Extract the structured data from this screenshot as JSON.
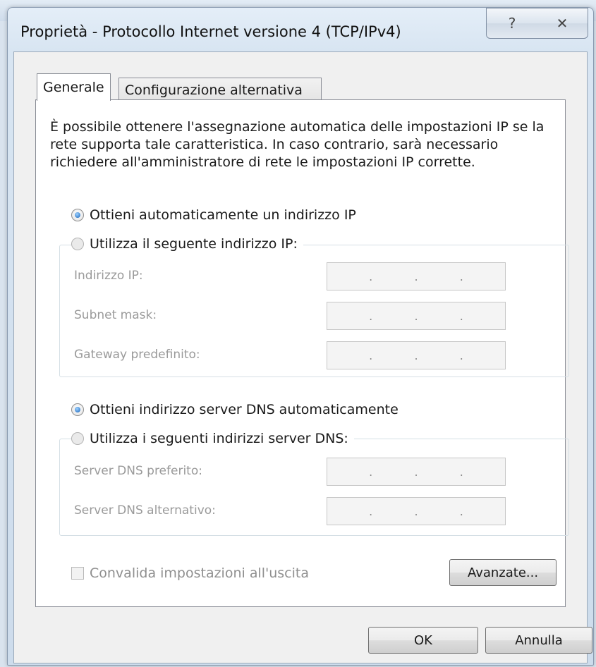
{
  "window": {
    "title": "Proprietà - Protocollo Internet versione 4 (TCP/IPv4)",
    "help_glyph": "?",
    "close_glyph": "✕"
  },
  "tabs": [
    {
      "label": "Generale",
      "active": true
    },
    {
      "label": "Configurazione alternativa",
      "active": false
    }
  ],
  "description": "È possibile ottenere l'assegnazione automatica delle impostazioni IP se la rete supporta tale caratteristica. In caso contrario, sarà necessario richiedere all'amministratore di rete le impostazioni IP corrette.",
  "ip": {
    "auto_label": "Ottieni automaticamente un indirizzo IP",
    "auto_selected": true,
    "manual_label": "Utilizza il seguente indirizzo IP:",
    "fields": [
      {
        "label": "Indirizzo IP:",
        "value": ". . ."
      },
      {
        "label": "Subnet mask:",
        "value": ". . ."
      },
      {
        "label": "Gateway predefinito:",
        "value": ". . ."
      }
    ]
  },
  "dns": {
    "auto_label": "Ottieni indirizzo server DNS automaticamente",
    "auto_selected": true,
    "manual_label": "Utilizza i seguenti indirizzi server DNS:",
    "fields": [
      {
        "label": "Server DNS preferito:",
        "value": ". . ."
      },
      {
        "label": "Server DNS alternativo:",
        "value": ". . ."
      }
    ]
  },
  "validate_label": "Convalida impostazioni all'uscita",
  "validate_checked": false,
  "buttons": {
    "advanced": "Avanzate...",
    "ok": "OK",
    "cancel": "Annulla"
  },
  "colors": {
    "accent_radio": "#1560b8",
    "disabled_text": "#9a9a9a"
  }
}
